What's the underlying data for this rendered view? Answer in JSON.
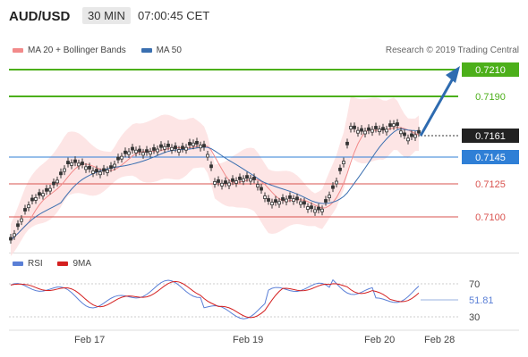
{
  "header": {
    "pair": "AUD/USD",
    "timeframe": "30 MIN",
    "time": "07:00:45 CET"
  },
  "legend": {
    "ma20_label": "MA 20 + Bollinger Bands",
    "ma50_label": "MA 50",
    "ma20_color": "#f28a8a",
    "ma50_color": "#3a6fb0"
  },
  "research": "Research © 2019 Trading Central",
  "levels": [
    {
      "label": "0.7210",
      "kind": "resistance-target",
      "color": "#4caf1a"
    },
    {
      "label": "0.7190",
      "kind": "resistance",
      "color": "#4caf1a"
    },
    {
      "label": "0.7161",
      "kind": "last-price",
      "color": "#222222"
    },
    {
      "label": "0.7145",
      "kind": "pivot",
      "color": "#2f7fd6"
    },
    {
      "label": "0.7125",
      "kind": "support",
      "color": "#d9534f"
    },
    {
      "label": "0.7100",
      "kind": "support",
      "color": "#d9534f"
    }
  ],
  "rsi": {
    "rsi_label": "RSI",
    "ma_label": "9MA",
    "rsi_color": "#5a7fd6",
    "ma_color": "#d42020",
    "level_high": "70",
    "level_low": "30",
    "value": "51.81"
  },
  "xaxis": {
    "labels": [
      "Feb 17",
      "Feb 19",
      "Feb 20",
      "Feb 28"
    ]
  }
}
